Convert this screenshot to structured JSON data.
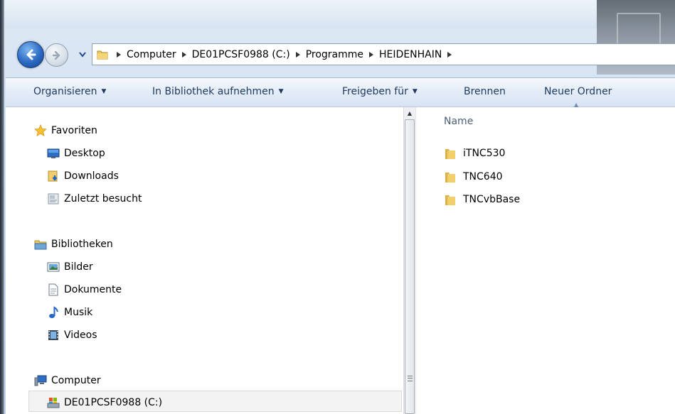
{
  "window": {
    "accent": "#2a69c4"
  },
  "navigation": {
    "back_icon": "arrow-left-icon",
    "forward_icon": "arrow-right-icon",
    "recent_icon": "chevron-down-icon"
  },
  "address_bar": {
    "icon": "folder-icon",
    "crumbs": [
      "Computer",
      "DE01PCSF0988 (C:)",
      "Programme",
      "HEIDENHAIN"
    ]
  },
  "toolbar": {
    "organize": "Organisieren",
    "include_library": "In Bibliothek aufnehmen",
    "share": "Freigeben für",
    "burn": "Brennen",
    "new_folder": "Neuer Ordner"
  },
  "nav_pane": {
    "favorites": {
      "label": "Favoriten",
      "icon": "star-icon",
      "items": [
        {
          "label": "Desktop",
          "icon": "desktop-icon"
        },
        {
          "label": "Downloads",
          "icon": "downloads-folder-icon"
        },
        {
          "label": "Zuletzt besucht",
          "icon": "recent-places-icon"
        }
      ]
    },
    "libraries": {
      "label": "Bibliotheken",
      "icon": "library-icon",
      "items": [
        {
          "label": "Bilder",
          "icon": "pictures-icon"
        },
        {
          "label": "Dokumente",
          "icon": "documents-icon"
        },
        {
          "label": "Musik",
          "icon": "music-icon"
        },
        {
          "label": "Videos",
          "icon": "videos-icon"
        }
      ]
    },
    "computer": {
      "label": "Computer",
      "icon": "computer-icon",
      "items": [
        {
          "label": "DE01PCSF0988 (C:)",
          "icon": "drive-icon",
          "selected": true
        }
      ]
    }
  },
  "content": {
    "column_name": "Name",
    "sort": "ascending",
    "files": [
      {
        "name": "iTNC530",
        "icon": "folder-icon"
      },
      {
        "name": "TNC640",
        "icon": "folder-icon"
      },
      {
        "name": "TNCvbBase",
        "icon": "folder-icon"
      }
    ]
  }
}
